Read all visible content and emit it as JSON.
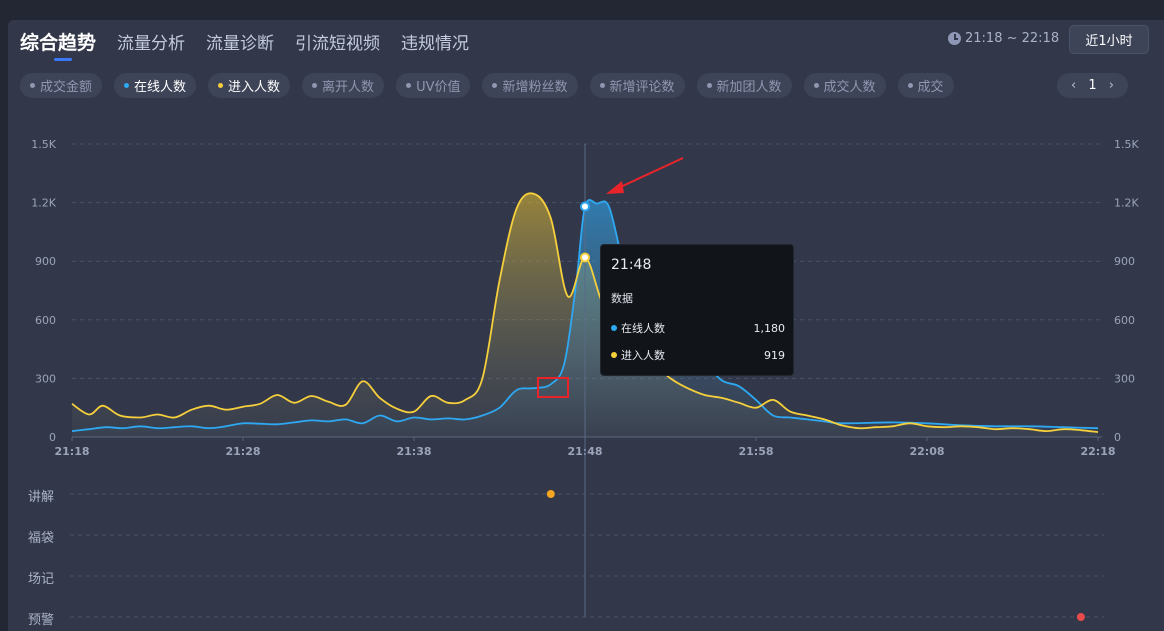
{
  "tabs": [
    {
      "label": "综合趋势",
      "active": true
    },
    {
      "label": "流量分析",
      "active": false
    },
    {
      "label": "流量诊断",
      "active": false
    },
    {
      "label": "引流短视频",
      "active": false
    },
    {
      "label": "违规情况",
      "active": false
    }
  ],
  "time_range": "21:18 ~ 22:18",
  "range_button": "近1小时",
  "metrics": [
    {
      "label": "成交金额",
      "on": false,
      "color": "#8f97b1"
    },
    {
      "label": "在线人数",
      "on": true,
      "color": "#2ea8f2"
    },
    {
      "label": "进入人数",
      "on": true,
      "color": "#f6cf3c"
    },
    {
      "label": "离开人数",
      "on": false,
      "color": "#8f97b1"
    },
    {
      "label": "UV价值",
      "on": false,
      "color": "#8f97b1"
    },
    {
      "label": "新增粉丝数",
      "on": false,
      "color": "#8f97b1"
    },
    {
      "label": "新增评论数",
      "on": false,
      "color": "#8f97b1"
    },
    {
      "label": "新加团人数",
      "on": false,
      "color": "#8f97b1"
    },
    {
      "label": "成交人数",
      "on": false,
      "color": "#8f97b1"
    },
    {
      "label": "成交",
      "on": false,
      "color": "#8f97b1"
    }
  ],
  "pager": {
    "prev": "‹",
    "page": "1",
    "next": "›"
  },
  "tooltip": {
    "time": "21:48",
    "header": "数据",
    "rows": [
      {
        "label": "在线人数",
        "value": "1,180",
        "color": "#2ea8f2"
      },
      {
        "label": "进入人数",
        "value": "919",
        "color": "#f6cf3c"
      }
    ]
  },
  "events": [
    {
      "label": "讲解",
      "marker_time": 28,
      "marker_color": "#f5a623"
    },
    {
      "label": "福袋"
    },
    {
      "label": "场记"
    },
    {
      "label": "预警",
      "marker_time": 59,
      "marker_color": "#e84b4b"
    }
  ],
  "chart_data": {
    "type": "area",
    "x_labels": [
      "21:18",
      "21:28",
      "21:38",
      "21:48",
      "21:58",
      "22:08",
      "22:18"
    ],
    "x_unit": "minutes after 21:18",
    "y_ticks": [
      "0",
      "300",
      "600",
      "900",
      "1.2K",
      "1.5K"
    ],
    "ylim": [
      0,
      1500
    ],
    "grid": true,
    "crosshair_x": 30,
    "series": [
      {
        "name": "在线人数",
        "color": "#2ea8f2",
        "points": [
          [
            0,
            30
          ],
          [
            1,
            40
          ],
          [
            2,
            50
          ],
          [
            3,
            45
          ],
          [
            4,
            55
          ],
          [
            5,
            45
          ],
          [
            6,
            50
          ],
          [
            7,
            55
          ],
          [
            8,
            45
          ],
          [
            9,
            55
          ],
          [
            10,
            70
          ],
          [
            11,
            68
          ],
          [
            12,
            65
          ],
          [
            13,
            75
          ],
          [
            14,
            85
          ],
          [
            15,
            80
          ],
          [
            16,
            90
          ],
          [
            17,
            70
          ],
          [
            18,
            110
          ],
          [
            19,
            80
          ],
          [
            20,
            100
          ],
          [
            21,
            90
          ],
          [
            22,
            95
          ],
          [
            23,
            90
          ],
          [
            24,
            110
          ],
          [
            25,
            150
          ],
          [
            26,
            240
          ],
          [
            27,
            250
          ],
          [
            28,
            270
          ],
          [
            28.8,
            380
          ],
          [
            29.5,
            800
          ],
          [
            30,
            1180
          ],
          [
            30.7,
            1195
          ],
          [
            31.4,
            1180
          ],
          [
            32.2,
            900
          ],
          [
            33,
            680
          ],
          [
            34,
            560
          ],
          [
            35,
            500
          ],
          [
            36,
            460
          ],
          [
            37,
            380
          ],
          [
            38,
            290
          ],
          [
            39,
            260
          ],
          [
            40,
            190
          ],
          [
            41,
            110
          ],
          [
            42,
            100
          ],
          [
            43,
            90
          ],
          [
            44,
            80
          ],
          [
            45,
            70
          ],
          [
            48,
            75
          ],
          [
            50,
            70
          ],
          [
            52,
            60
          ],
          [
            54,
            55
          ],
          [
            56,
            55
          ],
          [
            58,
            50
          ],
          [
            60,
            45
          ]
        ]
      },
      {
        "name": "进入人数",
        "color": "#f6cf3c",
        "points": [
          [
            0,
            170
          ],
          [
            1,
            115
          ],
          [
            1.8,
            160
          ],
          [
            2.8,
            110
          ],
          [
            4,
            100
          ],
          [
            5,
            115
          ],
          [
            6,
            100
          ],
          [
            7,
            140
          ],
          [
            8,
            160
          ],
          [
            9,
            140
          ],
          [
            10,
            155
          ],
          [
            11,
            170
          ],
          [
            12,
            215
          ],
          [
            13,
            175
          ],
          [
            14,
            210
          ],
          [
            15,
            180
          ],
          [
            16,
            165
          ],
          [
            17,
            285
          ],
          [
            18,
            200
          ],
          [
            19,
            145
          ],
          [
            20,
            130
          ],
          [
            21,
            210
          ],
          [
            22,
            175
          ],
          [
            23,
            190
          ],
          [
            24,
            300
          ],
          [
            25,
            800
          ],
          [
            26,
            1170
          ],
          [
            27,
            1245
          ],
          [
            28,
            1120
          ],
          [
            29,
            720
          ],
          [
            30,
            919
          ],
          [
            31,
            690
          ],
          [
            32,
            560
          ],
          [
            33,
            470
          ],
          [
            34,
            380
          ],
          [
            35,
            300
          ],
          [
            36,
            250
          ],
          [
            37,
            215
          ],
          [
            38,
            200
          ],
          [
            39,
            175
          ],
          [
            40,
            150
          ],
          [
            41,
            190
          ],
          [
            42,
            130
          ],
          [
            43,
            110
          ],
          [
            44,
            90
          ],
          [
            45,
            60
          ],
          [
            46,
            45
          ],
          [
            47,
            50
          ],
          [
            48,
            55
          ],
          [
            49,
            70
          ],
          [
            50,
            55
          ],
          [
            51,
            50
          ],
          [
            52,
            55
          ],
          [
            53,
            50
          ],
          [
            54,
            40
          ],
          [
            55,
            45
          ],
          [
            56,
            40
          ],
          [
            57,
            30
          ],
          [
            58,
            40
          ],
          [
            59,
            35
          ],
          [
            60,
            25
          ]
        ]
      }
    ]
  }
}
